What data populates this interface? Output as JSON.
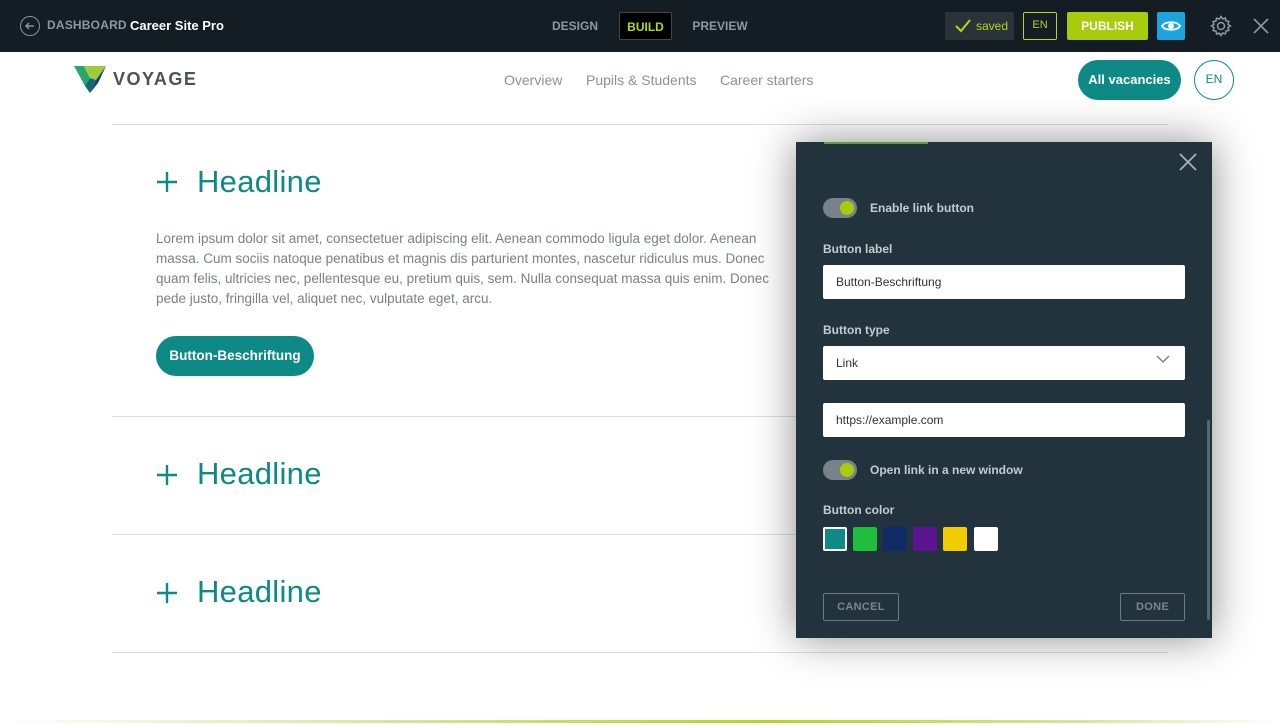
{
  "topbar": {
    "dashboard_label": "DASHBOARD",
    "site_name": "Career Site Pro",
    "tabs": {
      "design": "DESIGN",
      "build": "BUILD",
      "preview": "PREVIEW"
    },
    "active_tab": "BUILD",
    "saved_label": "saved",
    "language": "EN",
    "publish_label": "PUBLISH"
  },
  "site": {
    "logo_text": "VOYAGE",
    "nav": [
      "Overview",
      "Pupils & Students",
      "Career starters"
    ],
    "vacancies_button": "All vacancies",
    "lang_button": "EN"
  },
  "accordion": [
    {
      "headline": "Headline",
      "plus": "+",
      "body": "Lorem ipsum dolor sit amet, consectetuer adipiscing elit. Aenean commodo ligula eget dolor. Aenean massa. Cum sociis natoque penatibus et magnis dis parturient montes, nascetur ridiculus mus. Donec quam felis, ultricies nec, pellentesque eu, pretium quis, sem. Nulla consequat massa quis enim. Donec pede justo, fringilla vel, aliquet nec, vulputate eget, arcu.",
      "button_label": "Button-Beschriftung"
    },
    {
      "headline": "Headline",
      "plus": "+"
    },
    {
      "headline": "Headline",
      "plus": "+"
    }
  ],
  "panel": {
    "enable_link_label": "Enable link button",
    "enable_link_on": true,
    "button_label_title": "Button label",
    "button_label_value": "Button-Beschriftung",
    "button_type_title": "Button type",
    "button_type_value": "Link",
    "url_value": "https://example.com",
    "new_window_label": "Open link in a new window",
    "new_window_on": true,
    "button_color_title": "Button color",
    "colors": [
      "#0e8a86",
      "#1fbf3c",
      "#0f2a66",
      "#5b1490",
      "#f2cc00",
      "#ffffff"
    ],
    "selected_color": "#0e8a86",
    "cancel_label": "CANCEL",
    "done_label": "DONE"
  }
}
